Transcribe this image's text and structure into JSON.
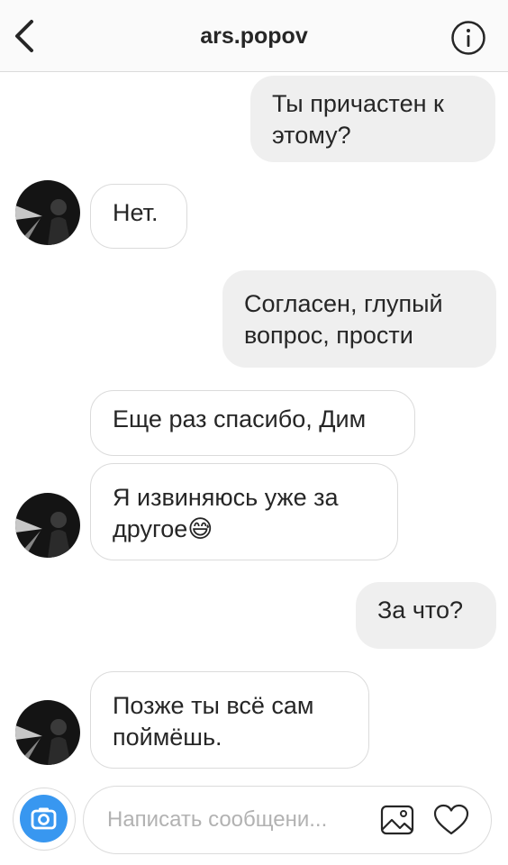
{
  "header": {
    "title": "ars.popov",
    "back_icon": "chevron-left-icon",
    "info_icon": "info-icon"
  },
  "messages": [
    {
      "direction": "outgoing",
      "text": "Ты причастен к\nэтому?"
    },
    {
      "direction": "incoming",
      "text": "Нет."
    },
    {
      "direction": "outgoing",
      "text": "Согласен, глупый\nвопрос, прости"
    },
    {
      "direction": "incoming",
      "text": "Еще раз спасибо, Дим"
    },
    {
      "direction": "incoming",
      "text": "Я извиняюсь уже за\nдругое😅"
    },
    {
      "direction": "outgoing",
      "text": "За что?"
    },
    {
      "direction": "incoming",
      "text": "Позже ты всё сам\nпоймёшь."
    }
  ],
  "composer": {
    "placeholder": "Написать сообщени...",
    "camera_icon": "camera-icon",
    "gallery_icon": "gallery-icon",
    "like_icon": "heart-icon"
  },
  "colors": {
    "accent": "#3897f0",
    "outgoing_bubble": "#efefef",
    "border": "#dbdbdb",
    "text": "#262626",
    "placeholder": "#b2b2b2"
  }
}
